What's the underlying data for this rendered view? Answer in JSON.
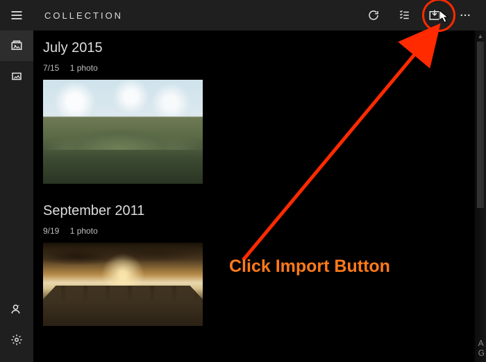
{
  "header": {
    "title": "COLLECTION"
  },
  "sidebar": {
    "items": [
      {
        "name": "hamburger"
      },
      {
        "name": "collection",
        "selected": true
      },
      {
        "name": "albums"
      }
    ],
    "bottom": [
      {
        "name": "sign-in"
      },
      {
        "name": "settings"
      }
    ]
  },
  "sections": [
    {
      "title": "July 2015",
      "date": "7/15",
      "count_label": "1 photo"
    },
    {
      "title": "September 2011",
      "date": "9/19",
      "count_label": "1 photo"
    }
  ],
  "annotation": {
    "text": "Click Import Button",
    "color": "#ff7a1a"
  },
  "peek": {
    "line1": "A",
    "line2": "G"
  }
}
